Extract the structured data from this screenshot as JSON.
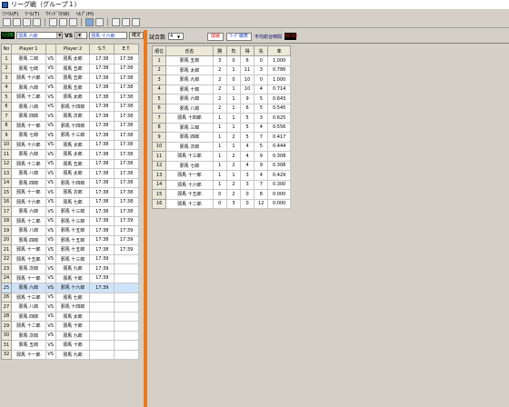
{
  "window": {
    "title": "リーグ戦（グループ１）"
  },
  "menu": [
    "ﾌｧｲﾙ(F)",
    "ﾂｰﾙ(T)",
    "ｳｲﾝﾄﾞｳ(W)",
    "ﾍﾙﾌﾟ(H)"
  ],
  "controls": {
    "round_label": "1回戦",
    "player1": "邪馬 六郎",
    "vs": "VS",
    "player2": "邪馬 十六郎",
    "confirm": "確定"
  },
  "match_headers": {
    "no": "No",
    "p1": "Player 1",
    "vs": "",
    "p2": "Player 2",
    "st": "S.T.",
    "et": "E.T."
  },
  "matches": [
    {
      "no": "1",
      "p1": "邪馬 二郎",
      "vs": "VS",
      "p2": "邪馬 太郎",
      "st": "17:38",
      "et": "17:38"
    },
    {
      "no": "2",
      "p1": "邪馬 七郎",
      "vs": "VS",
      "p2": "邪馬 五郎",
      "st": "17:38",
      "et": "17:38"
    },
    {
      "no": "3",
      "p1": "邪馬 十六郎",
      "vs": "VS",
      "p2": "邪馬 五郎",
      "st": "17:38",
      "et": "17:38"
    },
    {
      "no": "4",
      "p1": "邪馬 六郎",
      "vs": "VS",
      "p2": "邪馬 五郎",
      "st": "17:38",
      "et": "17:38"
    },
    {
      "no": "5",
      "p1": "邪馬 十二郎",
      "vs": "VS",
      "p2": "邪馬 太郎",
      "st": "17:38",
      "et": "17:38"
    },
    {
      "no": "6",
      "p1": "邪馬 八郎",
      "vs": "VS",
      "p2": "邪馬 十四郎",
      "st": "17:38",
      "et": "17:38"
    },
    {
      "no": "7",
      "p1": "邪馬 四郎",
      "vs": "VS",
      "p2": "邪馬 次郎",
      "st": "17:38",
      "et": "17:38"
    },
    {
      "no": "8",
      "p1": "邪馬 十一郎",
      "vs": "VS",
      "p2": "邪馬 十四郎",
      "st": "17:38",
      "et": "17:38"
    },
    {
      "no": "9",
      "p1": "邪馬 七郎",
      "vs": "VS",
      "p2": "邪馬 十三郎",
      "st": "17:38",
      "et": "17:38"
    },
    {
      "no": "10",
      "p1": "邪馬 十六郎",
      "vs": "VS",
      "p2": "邪馬 太郎",
      "st": "17:38",
      "et": "17:38"
    },
    {
      "no": "11",
      "p1": "邪馬 六郎",
      "vs": "VS",
      "p2": "邪馬 太郎",
      "st": "17:38",
      "et": "17:38"
    },
    {
      "no": "12",
      "p1": "邪馬 十二郎",
      "vs": "VS",
      "p2": "邪馬 五郎",
      "st": "17:38",
      "et": "17:38"
    },
    {
      "no": "13",
      "p1": "邪馬 八郎",
      "vs": "VS",
      "p2": "邪馬 太郎",
      "st": "17:38",
      "et": "17:38"
    },
    {
      "no": "14",
      "p1": "邪馬 四郎",
      "vs": "VS",
      "p2": "邪馬 十四郎",
      "st": "17:38",
      "et": "17:38"
    },
    {
      "no": "15",
      "p1": "邪馬 十一郎",
      "vs": "VS",
      "p2": "邪馬 次郎",
      "st": "17:38",
      "et": "17:38"
    },
    {
      "no": "16",
      "p1": "邪馬 十六郎",
      "vs": "VS",
      "p2": "邪馬 七郎",
      "st": "17:38",
      "et": "17:38"
    },
    {
      "no": "17",
      "p1": "邪馬 六郎",
      "vs": "VS",
      "p2": "邪馬 十三郎",
      "st": "17:38",
      "et": "17:38"
    },
    {
      "no": "18",
      "p1": "邪馬 十二郎",
      "vs": "VS",
      "p2": "邪馬 十三郎",
      "st": "17:38",
      "et": "17:39"
    },
    {
      "no": "19",
      "p1": "邪馬 八郎",
      "vs": "VS",
      "p2": "邪馬 十五郎",
      "st": "17:38",
      "et": "17:39"
    },
    {
      "no": "20",
      "p1": "邪馬 四郎",
      "vs": "VS",
      "p2": "邪馬 十五郎",
      "st": "17:38",
      "et": "17:39"
    },
    {
      "no": "21",
      "p1": "邪馬 十一郎",
      "vs": "VS",
      "p2": "邪馬 十五郎",
      "st": "17:38",
      "et": "17:39"
    },
    {
      "no": "22",
      "p1": "邪馬 十五郎",
      "vs": "VS",
      "p2": "邪馬 十三郎",
      "st": "17:39",
      "et": ""
    },
    {
      "no": "23",
      "p1": "邪馬 次郎",
      "vs": "VS",
      "p2": "邪馬 九郎",
      "st": "17:39",
      "et": ""
    },
    {
      "no": "24",
      "p1": "邪馬 十一郎",
      "vs": "VS",
      "p2": "邪馬 十郎",
      "st": "17:39",
      "et": ""
    },
    {
      "no": "25",
      "p1": "邪馬 六郎",
      "vs": "VS",
      "p2": "邪馬 十六郎",
      "st": "17:39",
      "et": ""
    },
    {
      "no": "26",
      "p1": "邪馬 十三郎",
      "vs": "VS",
      "p2": "邪馬 七郎",
      "st": "",
      "et": ""
    },
    {
      "no": "27",
      "p1": "邪馬 八郎",
      "vs": "VS",
      "p2": "邪馬 十四郎",
      "st": "",
      "et": ""
    },
    {
      "no": "28",
      "p1": "邪馬 四郎",
      "vs": "VS",
      "p2": "邪馬 太郎",
      "st": "",
      "et": ""
    },
    {
      "no": "29",
      "p1": "邪馬 十二郎",
      "vs": "VS",
      "p2": "邪馬 十郎",
      "st": "",
      "et": ""
    },
    {
      "no": "30",
      "p1": "邪馬 次郎",
      "vs": "VS",
      "p2": "邪馬 九郎",
      "st": "",
      "et": ""
    },
    {
      "no": "31",
      "p1": "邪馬 五郎",
      "vs": "VS",
      "p2": "邪馬 十郎",
      "st": "",
      "et": ""
    },
    {
      "no": "32",
      "p1": "邪馬 十一郎",
      "vs": "VS",
      "p2": "邪馬 九郎",
      "st": "",
      "et": ""
    }
  ],
  "selected_match": "25",
  "right_controls": {
    "games_label": "試合数",
    "games_value": "4",
    "ranking_btn": "成績",
    "league_btn": "ﾘｰｸﾞ戦表",
    "avg_label": "平均総合時間",
    "avg_value": "00:00"
  },
  "rank_headers": {
    "rank": "順位",
    "name": "氏名",
    "win": "勝",
    "lose": "負",
    "plus": "得",
    "minus": "失",
    "rate": "率"
  },
  "rankings": [
    {
      "rank": "1",
      "name": "邪馬 五郎",
      "win": "3",
      "lose": "0",
      "plus": "6",
      "minus": "0",
      "rate": "1.000"
    },
    {
      "rank": "2",
      "name": "邪馬 太郎",
      "win": "2",
      "lose": "1",
      "plus": "11",
      "minus": "3",
      "rate": "0.786"
    },
    {
      "rank": "3",
      "name": "邪馬 九郎",
      "win": "2",
      "lose": "0",
      "plus": "10",
      "minus": "0",
      "rate": "1.000"
    },
    {
      "rank": "4",
      "name": "邪馬 十郎",
      "win": "2",
      "lose": "1",
      "plus": "10",
      "minus": "4",
      "rate": "0.714"
    },
    {
      "rank": "5",
      "name": "邪馬 六郎",
      "win": "2",
      "lose": "1",
      "plus": "9",
      "minus": "5",
      "rate": "0.643"
    },
    {
      "rank": "6",
      "name": "邪馬 八郎",
      "win": "2",
      "lose": "1",
      "plus": "6",
      "minus": "5",
      "rate": "0.545"
    },
    {
      "rank": "7",
      "name": "邪馬 十四郎",
      "win": "1",
      "lose": "1",
      "plus": "5",
      "minus": "3",
      "rate": "0.625"
    },
    {
      "rank": "8",
      "name": "邪馬 三郎",
      "win": "1",
      "lose": "1",
      "plus": "5",
      "minus": "4",
      "rate": "0.556"
    },
    {
      "rank": "9",
      "name": "邪馬 四郎",
      "win": "1",
      "lose": "2",
      "plus": "5",
      "minus": "7",
      "rate": "0.417"
    },
    {
      "rank": "10",
      "name": "邪馬 次郎",
      "win": "1",
      "lose": "1",
      "plus": "4",
      "minus": "5",
      "rate": "0.444"
    },
    {
      "rank": "11",
      "name": "邪馬 十三郎",
      "win": "1",
      "lose": "2",
      "plus": "4",
      "minus": "9",
      "rate": "0.308"
    },
    {
      "rank": "12",
      "name": "邪馬 七郎",
      "win": "1",
      "lose": "2",
      "plus": "4",
      "minus": "9",
      "rate": "0.308"
    },
    {
      "rank": "13",
      "name": "邪馬 十一郎",
      "win": "1",
      "lose": "1",
      "plus": "3",
      "minus": "4",
      "rate": "0.429"
    },
    {
      "rank": "14",
      "name": "邪馬 十六郎",
      "win": "1",
      "lose": "2",
      "plus": "3",
      "minus": "7",
      "rate": "0.300"
    },
    {
      "rank": "15",
      "name": "邪馬 十五郎",
      "win": "0",
      "lose": "2",
      "plus": "0",
      "minus": "8",
      "rate": "0.000"
    },
    {
      "rank": "16",
      "name": "邪馬 十二郎",
      "win": "0",
      "lose": "3",
      "plus": "0",
      "minus": "12",
      "rate": "0.000"
    }
  ]
}
